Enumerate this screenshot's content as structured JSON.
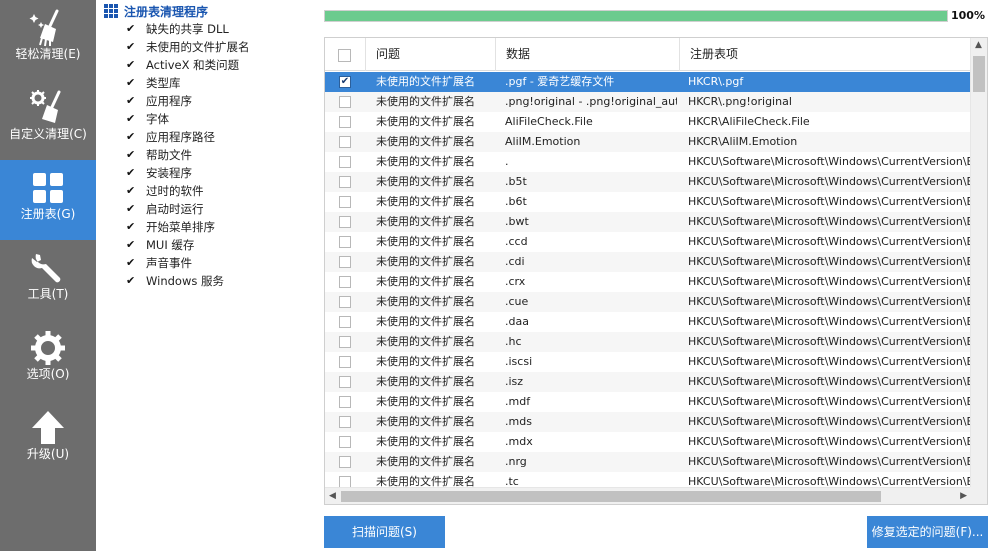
{
  "nav": [
    {
      "label": "轻松清理(E)",
      "icon": "sparkle-broom-icon"
    },
    {
      "label": "自定义清理(C)",
      "icon": "gear-broom-icon"
    },
    {
      "label": "注册表(G)",
      "icon": "grid-icon"
    },
    {
      "label": "工具(T)",
      "icon": "wrench-icon"
    },
    {
      "label": "选项(O)",
      "icon": "gear-icon"
    },
    {
      "label": "升级(U)",
      "icon": "arrow-up-icon"
    }
  ],
  "active_nav": "注册表(G)",
  "tree": {
    "title": "注册表清理程序",
    "items": [
      "缺失的共享 DLL",
      "未使用的文件扩展名",
      "ActiveX 和类问题",
      "类型库",
      "应用程序",
      "字体",
      "应用程序路径",
      "帮助文件",
      "安装程序",
      "过时的软件",
      "启动时运行",
      "开始菜单排序",
      "MUI 缓存",
      "声音事件",
      "Windows 服务"
    ]
  },
  "progress": {
    "percent": 100,
    "label": "100%"
  },
  "table": {
    "columns": [
      "问题",
      "数据",
      "注册表项"
    ],
    "rows": [
      {
        "checked": true,
        "issue": "未使用的文件扩展名",
        "data": ".pgf - 爱奇艺缓存文件",
        "key": "HKCR\\.pgf"
      },
      {
        "checked": false,
        "issue": "未使用的文件扩展名",
        "data": ".png!original - .png!original_aut...",
        "key": "HKCR\\.png!original"
      },
      {
        "checked": false,
        "issue": "未使用的文件扩展名",
        "data": "AliFileCheck.File",
        "key": "HKCR\\AliFileCheck.File"
      },
      {
        "checked": false,
        "issue": "未使用的文件扩展名",
        "data": "AliIM.Emotion",
        "key": "HKCR\\AliIM.Emotion"
      },
      {
        "checked": false,
        "issue": "未使用的文件扩展名",
        "data": ".",
        "key": "HKCU\\Software\\Microsoft\\Windows\\CurrentVersion\\Explore"
      },
      {
        "checked": false,
        "issue": "未使用的文件扩展名",
        "data": ".b5t",
        "key": "HKCU\\Software\\Microsoft\\Windows\\CurrentVersion\\Explore"
      },
      {
        "checked": false,
        "issue": "未使用的文件扩展名",
        "data": ".b6t",
        "key": "HKCU\\Software\\Microsoft\\Windows\\CurrentVersion\\Explore"
      },
      {
        "checked": false,
        "issue": "未使用的文件扩展名",
        "data": ".bwt",
        "key": "HKCU\\Software\\Microsoft\\Windows\\CurrentVersion\\Explore"
      },
      {
        "checked": false,
        "issue": "未使用的文件扩展名",
        "data": ".ccd",
        "key": "HKCU\\Software\\Microsoft\\Windows\\CurrentVersion\\Explore"
      },
      {
        "checked": false,
        "issue": "未使用的文件扩展名",
        "data": ".cdi",
        "key": "HKCU\\Software\\Microsoft\\Windows\\CurrentVersion\\Explore"
      },
      {
        "checked": false,
        "issue": "未使用的文件扩展名",
        "data": ".crx",
        "key": "HKCU\\Software\\Microsoft\\Windows\\CurrentVersion\\Explore"
      },
      {
        "checked": false,
        "issue": "未使用的文件扩展名",
        "data": ".cue",
        "key": "HKCU\\Software\\Microsoft\\Windows\\CurrentVersion\\Explore"
      },
      {
        "checked": false,
        "issue": "未使用的文件扩展名",
        "data": ".daa",
        "key": "HKCU\\Software\\Microsoft\\Windows\\CurrentVersion\\Explore"
      },
      {
        "checked": false,
        "issue": "未使用的文件扩展名",
        "data": ".hc",
        "key": "HKCU\\Software\\Microsoft\\Windows\\CurrentVersion\\Explore"
      },
      {
        "checked": false,
        "issue": "未使用的文件扩展名",
        "data": ".iscsi",
        "key": "HKCU\\Software\\Microsoft\\Windows\\CurrentVersion\\Explore"
      },
      {
        "checked": false,
        "issue": "未使用的文件扩展名",
        "data": ".isz",
        "key": "HKCU\\Software\\Microsoft\\Windows\\CurrentVersion\\Explore"
      },
      {
        "checked": false,
        "issue": "未使用的文件扩展名",
        "data": ".mdf",
        "key": "HKCU\\Software\\Microsoft\\Windows\\CurrentVersion\\Explore"
      },
      {
        "checked": false,
        "issue": "未使用的文件扩展名",
        "data": ".mds",
        "key": "HKCU\\Software\\Microsoft\\Windows\\CurrentVersion\\Explore"
      },
      {
        "checked": false,
        "issue": "未使用的文件扩展名",
        "data": ".mdx",
        "key": "HKCU\\Software\\Microsoft\\Windows\\CurrentVersion\\Explore"
      },
      {
        "checked": false,
        "issue": "未使用的文件扩展名",
        "data": ".nrg",
        "key": "HKCU\\Software\\Microsoft\\Windows\\CurrentVersion\\Explore"
      },
      {
        "checked": false,
        "issue": "未使用的文件扩展名",
        "data": ".tc",
        "key": "HKCU\\Software\\Microsoft\\Windows\\CurrentVersion\\Explore"
      }
    ]
  },
  "buttons": {
    "scan": "扫描问题(S)",
    "fix": "修复选定的问题(F)..."
  },
  "colors": {
    "accent": "#3a86d6",
    "nav_bg": "#6d6d6d",
    "progress": "#6ccb8e",
    "title": "#1a56b0"
  }
}
